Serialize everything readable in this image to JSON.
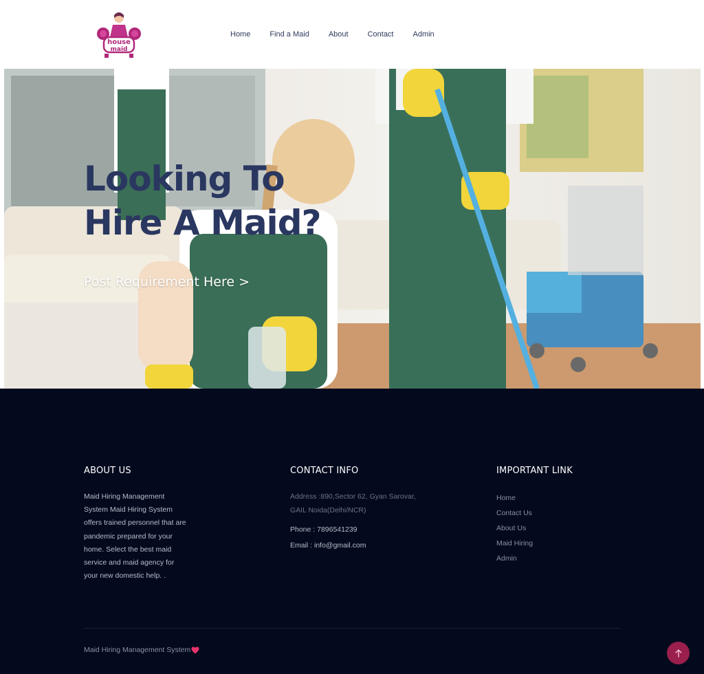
{
  "header": {
    "logo_icon": "house-maid-logo",
    "nav": [
      {
        "label": "Home"
      },
      {
        "label": "Find a Maid"
      },
      {
        "label": "About"
      },
      {
        "label": "Contact"
      },
      {
        "label": "Admin"
      }
    ]
  },
  "hero": {
    "title_line1": "Looking To",
    "title_line2": "Hire A Maid?",
    "cta": "Post Requirement Here >",
    "title_color": "#2a3760"
  },
  "footer": {
    "background": "#040a1e",
    "about": {
      "heading": "ABOUT US",
      "text": "Maid Hiring Management System Maid Hiring System offers trained personnel that are pandemic prepared for your home. Select the best maid service and maid agency for your new domestic help. ."
    },
    "contact": {
      "heading": "CONTACT INFO",
      "address": "Address :890,Sector 62, Gyan Sarovar, GAIL Noida(Delhi/NCR)",
      "phone": "Phone : 7896541239",
      "email": "Email : info@gmail.com"
    },
    "links": {
      "heading": "IMPORTANT LINK",
      "items": [
        {
          "label": "Home"
        },
        {
          "label": "Contact Us"
        },
        {
          "label": "About Us"
        },
        {
          "label": "Maid Hiring"
        },
        {
          "label": "Admin"
        }
      ]
    },
    "copyright": "Maid Hiring Management System",
    "heart_icon": "heart-icon",
    "heart_color": "#e8336a",
    "back_to_top_icon": "arrow-up-icon",
    "back_to_top_color": "#9a1f4c"
  }
}
